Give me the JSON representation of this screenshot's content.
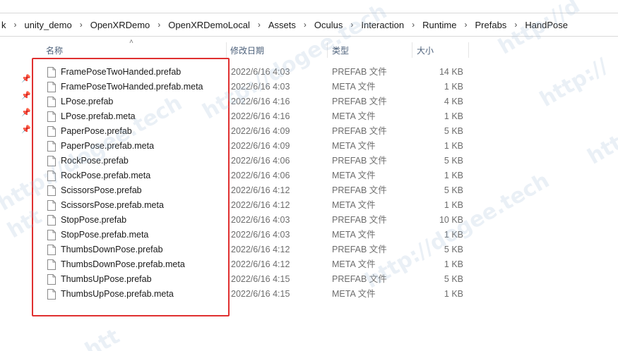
{
  "breadcrumb": [
    "k",
    "unity_demo",
    "OpenXRDemo",
    "OpenXRDemoLocal",
    "Assets",
    "Oculus",
    "Interaction",
    "Runtime",
    "Prefabs",
    "HandPose"
  ],
  "columns": {
    "name": "名称",
    "date": "修改日期",
    "type": "类型",
    "size": "大小"
  },
  "files": [
    {
      "name": "FramePoseTwoHanded.prefab",
      "date": "2022/6/16 4:03",
      "type": "PREFAB 文件",
      "size": "14 KB"
    },
    {
      "name": "FramePoseTwoHanded.prefab.meta",
      "date": "2022/6/16 4:03",
      "type": "META 文件",
      "size": "1 KB"
    },
    {
      "name": "LPose.prefab",
      "date": "2022/6/16 4:16",
      "type": "PREFAB 文件",
      "size": "4 KB"
    },
    {
      "name": "LPose.prefab.meta",
      "date": "2022/6/16 4:16",
      "type": "META 文件",
      "size": "1 KB"
    },
    {
      "name": "PaperPose.prefab",
      "date": "2022/6/16 4:09",
      "type": "PREFAB 文件",
      "size": "5 KB"
    },
    {
      "name": "PaperPose.prefab.meta",
      "date": "2022/6/16 4:09",
      "type": "META 文件",
      "size": "1 KB"
    },
    {
      "name": "RockPose.prefab",
      "date": "2022/6/16 4:06",
      "type": "PREFAB 文件",
      "size": "5 KB"
    },
    {
      "name": "RockPose.prefab.meta",
      "date": "2022/6/16 4:06",
      "type": "META 文件",
      "size": "1 KB"
    },
    {
      "name": "ScissorsPose.prefab",
      "date": "2022/6/16 4:12",
      "type": "PREFAB 文件",
      "size": "5 KB"
    },
    {
      "name": "ScissorsPose.prefab.meta",
      "date": "2022/6/16 4:12",
      "type": "META 文件",
      "size": "1 KB"
    },
    {
      "name": "StopPose.prefab",
      "date": "2022/6/16 4:03",
      "type": "PREFAB 文件",
      "size": "10 KB"
    },
    {
      "name": "StopPose.prefab.meta",
      "date": "2022/6/16 4:03",
      "type": "META 文件",
      "size": "1 KB"
    },
    {
      "name": "ThumbsDownPose.prefab",
      "date": "2022/6/16 4:12",
      "type": "PREFAB 文件",
      "size": "5 KB"
    },
    {
      "name": "ThumbsDownPose.prefab.meta",
      "date": "2022/6/16 4:12",
      "type": "META 文件",
      "size": "1 KB"
    },
    {
      "name": "ThumbsUpPose.prefab",
      "date": "2022/6/16 4:15",
      "type": "PREFAB 文件",
      "size": "5 KB"
    },
    {
      "name": "ThumbsUpPose.prefab.meta",
      "date": "2022/6/16 4:15",
      "type": "META 文件",
      "size": "1 KB"
    }
  ],
  "watermark": "http://dogee.tech",
  "watermark_fragments": [
    "http://d",
    "http://",
    "http://dogee.tech",
    "http",
    "http://dogee.tech",
    "http://dogee.tech",
    "htt"
  ],
  "colors": {
    "highlight_border": "#e03030",
    "header_text": "#4c607a",
    "detail_text": "#6d6d6d"
  }
}
